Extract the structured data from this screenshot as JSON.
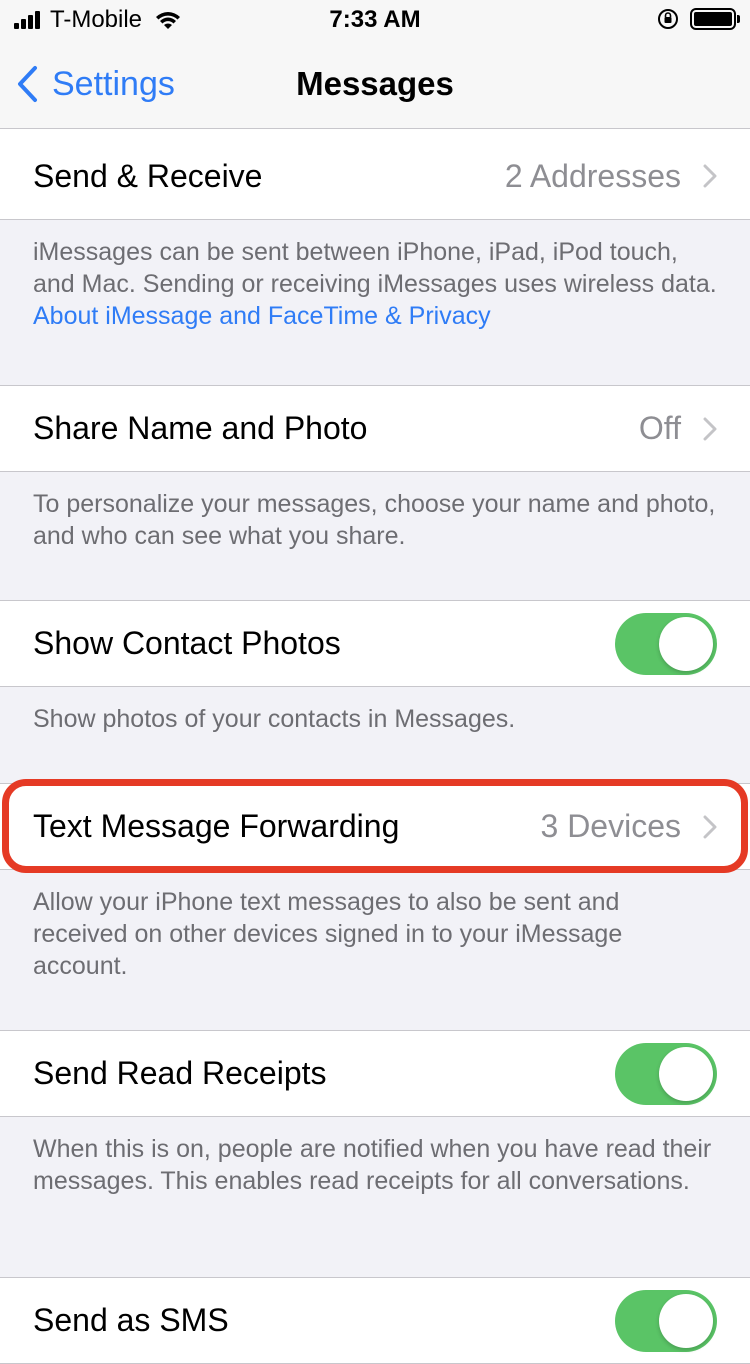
{
  "status_bar": {
    "carrier": "T-Mobile",
    "time": "7:33 AM"
  },
  "nav": {
    "back_label": "Settings",
    "title": "Messages"
  },
  "sections": {
    "send_receive": {
      "label": "Send & Receive",
      "detail": "2 Addresses",
      "footer_text": "iMessages can be sent between iPhone, iPad, iPod touch, and Mac. Sending or receiving iMessages uses wireless data. ",
      "footer_link": "About iMessage and FaceTime & Privacy"
    },
    "share_name": {
      "label": "Share Name and Photo",
      "detail": "Off",
      "footer_text": "To personalize your messages, choose your name and photo, and who can see what you share."
    },
    "contact_photos": {
      "label": "Show Contact Photos",
      "toggle": "on",
      "footer_text": "Show photos of your contacts in Messages."
    },
    "forwarding": {
      "label": "Text Message Forwarding",
      "detail": "3 Devices",
      "footer_text": "Allow your iPhone text messages to also be sent and received on other devices signed in to your iMessage account."
    },
    "read_receipts": {
      "label": "Send Read Receipts",
      "toggle": "on",
      "footer_text": "When this is on, people are notified when you have read their messages. This enables read receipts for all conversations."
    },
    "send_sms": {
      "label": "Send as SMS",
      "toggle": "on"
    }
  },
  "colors": {
    "accent": "#2f7cf6",
    "toggle_on": "#5ac466",
    "highlight": "#e53a25"
  }
}
